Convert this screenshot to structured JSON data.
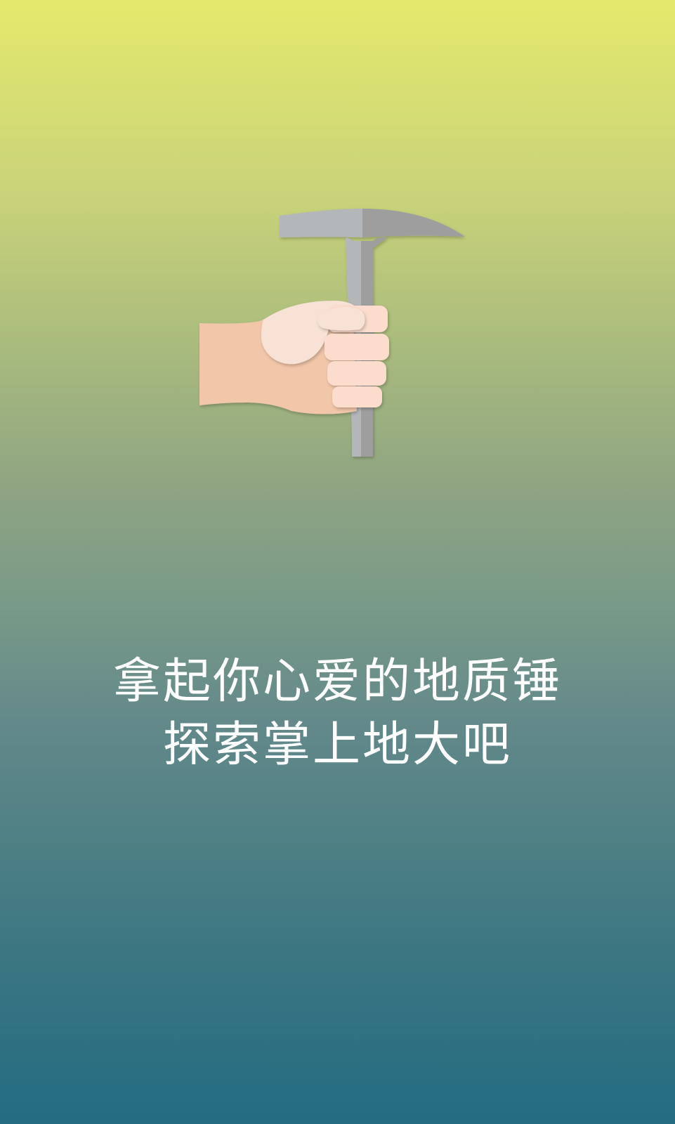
{
  "splash": {
    "illustration_icon": "hand-holding-geological-hammer-icon",
    "slogan_line1": "拿起你心爱的地质锤",
    "slogan_line2": "探索掌上地大吧"
  },
  "colors": {
    "gradient_top": "#e5e96c",
    "gradient_bottom": "#236c82",
    "text": "#ffffff",
    "hammer_light": "#b4b7b9",
    "hammer_dark": "#9e9e9e",
    "skin": "#f2c6a9",
    "skin_light": "#f7e2d5",
    "finger": "#fbdccd"
  }
}
